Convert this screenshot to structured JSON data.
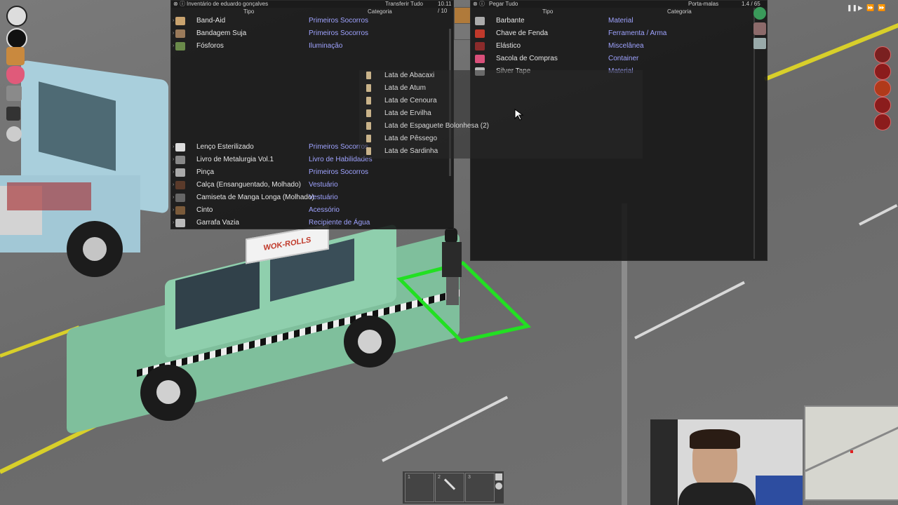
{
  "left_inventory": {
    "title": "Inventário de eduardo gonçalves",
    "transfer_all": "Transferir Tudo",
    "weight": "10.11 / 10",
    "col_type": "Tipo",
    "col_category": "Categoria",
    "items": [
      {
        "name": "Band-Aid",
        "category": "Primeiros Socorros"
      },
      {
        "name": "Bandagem Suja",
        "category": "Primeiros Socorros"
      },
      {
        "name": "Fósforos",
        "category": "Iluminação"
      },
      {
        "name": "Lenço Esterilizado",
        "category": "Primeiros Socorros"
      },
      {
        "name": "Livro de Metalurgia Vol.1",
        "category": "Livro de Habilidades"
      },
      {
        "name": "Pinça",
        "category": "Primeiros Socorros"
      },
      {
        "name": "Calça (Ensanguentado, Molhado)",
        "category": "Vestuário"
      },
      {
        "name": "Camiseta de Manga Longa (Molhado)",
        "category": "Vestuário"
      },
      {
        "name": "Cinto",
        "category": "Acessório"
      },
      {
        "name": "Garrafa Vazia",
        "category": "Recipiente de Água"
      }
    ],
    "submenu": [
      "Lata de Abacaxi",
      "Lata de Atum",
      "Lata de Cenoura",
      "Lata de Ervilha",
      "Lata de Espaguete Bolonhesa (2)",
      "Lata de Pêssego",
      "Lata de Sardinha"
    ]
  },
  "right_inventory": {
    "loot_all": "Pegar Tudo",
    "container": "Porta-malas",
    "weight": "1.4 / 65",
    "col_type": "Tipo",
    "col_category": "Categoria",
    "items": [
      {
        "name": "Barbante",
        "category": "Material"
      },
      {
        "name": "Chave de Fenda",
        "category": "Ferramenta / Arma"
      },
      {
        "name": "Elástico",
        "category": "Miscelânea"
      },
      {
        "name": "Sacola de Compras",
        "category": "Container"
      },
      {
        "name": "Silver Tape",
        "category": "Material"
      }
    ]
  },
  "hotbar": {
    "slots": [
      "1",
      "2",
      "3"
    ]
  },
  "taxi_sign": "WOK-ROLLS",
  "colors": {
    "category": "#9fa3ff",
    "highlight": "#22e022",
    "road_line": "#d8cf2a"
  }
}
